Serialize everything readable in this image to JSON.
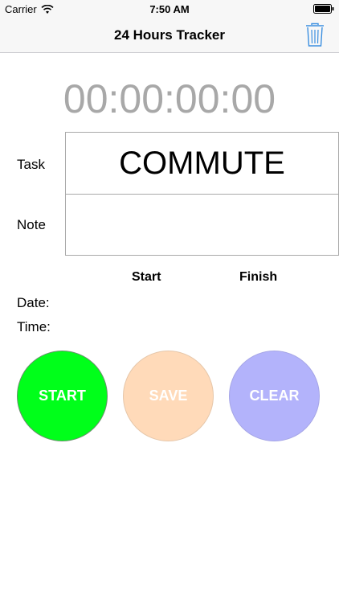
{
  "status_bar": {
    "carrier": "Carrier",
    "time": "7:50 AM",
    "wifi_icon": "wifi-icon",
    "battery_icon": "battery-icon"
  },
  "nav": {
    "title": "24 Hours Tracker",
    "trash_icon": "trash-icon"
  },
  "timer": {
    "display": "00:00:00:00"
  },
  "form": {
    "task_label": "Task",
    "task_value": "COMMUTE",
    "note_label": "Note",
    "note_value": "",
    "start_header": "Start",
    "finish_header": "Finish",
    "date_label": "Date:",
    "time_label": "Time:"
  },
  "buttons": {
    "start": "START",
    "save": "SAVE",
    "clear": "CLEAR"
  },
  "colors": {
    "start": "#00ff1a",
    "save": "#ffdab9",
    "clear": "#b3b3fb",
    "trash": "#3b8fe0",
    "timer": "#a8a8a8"
  }
}
